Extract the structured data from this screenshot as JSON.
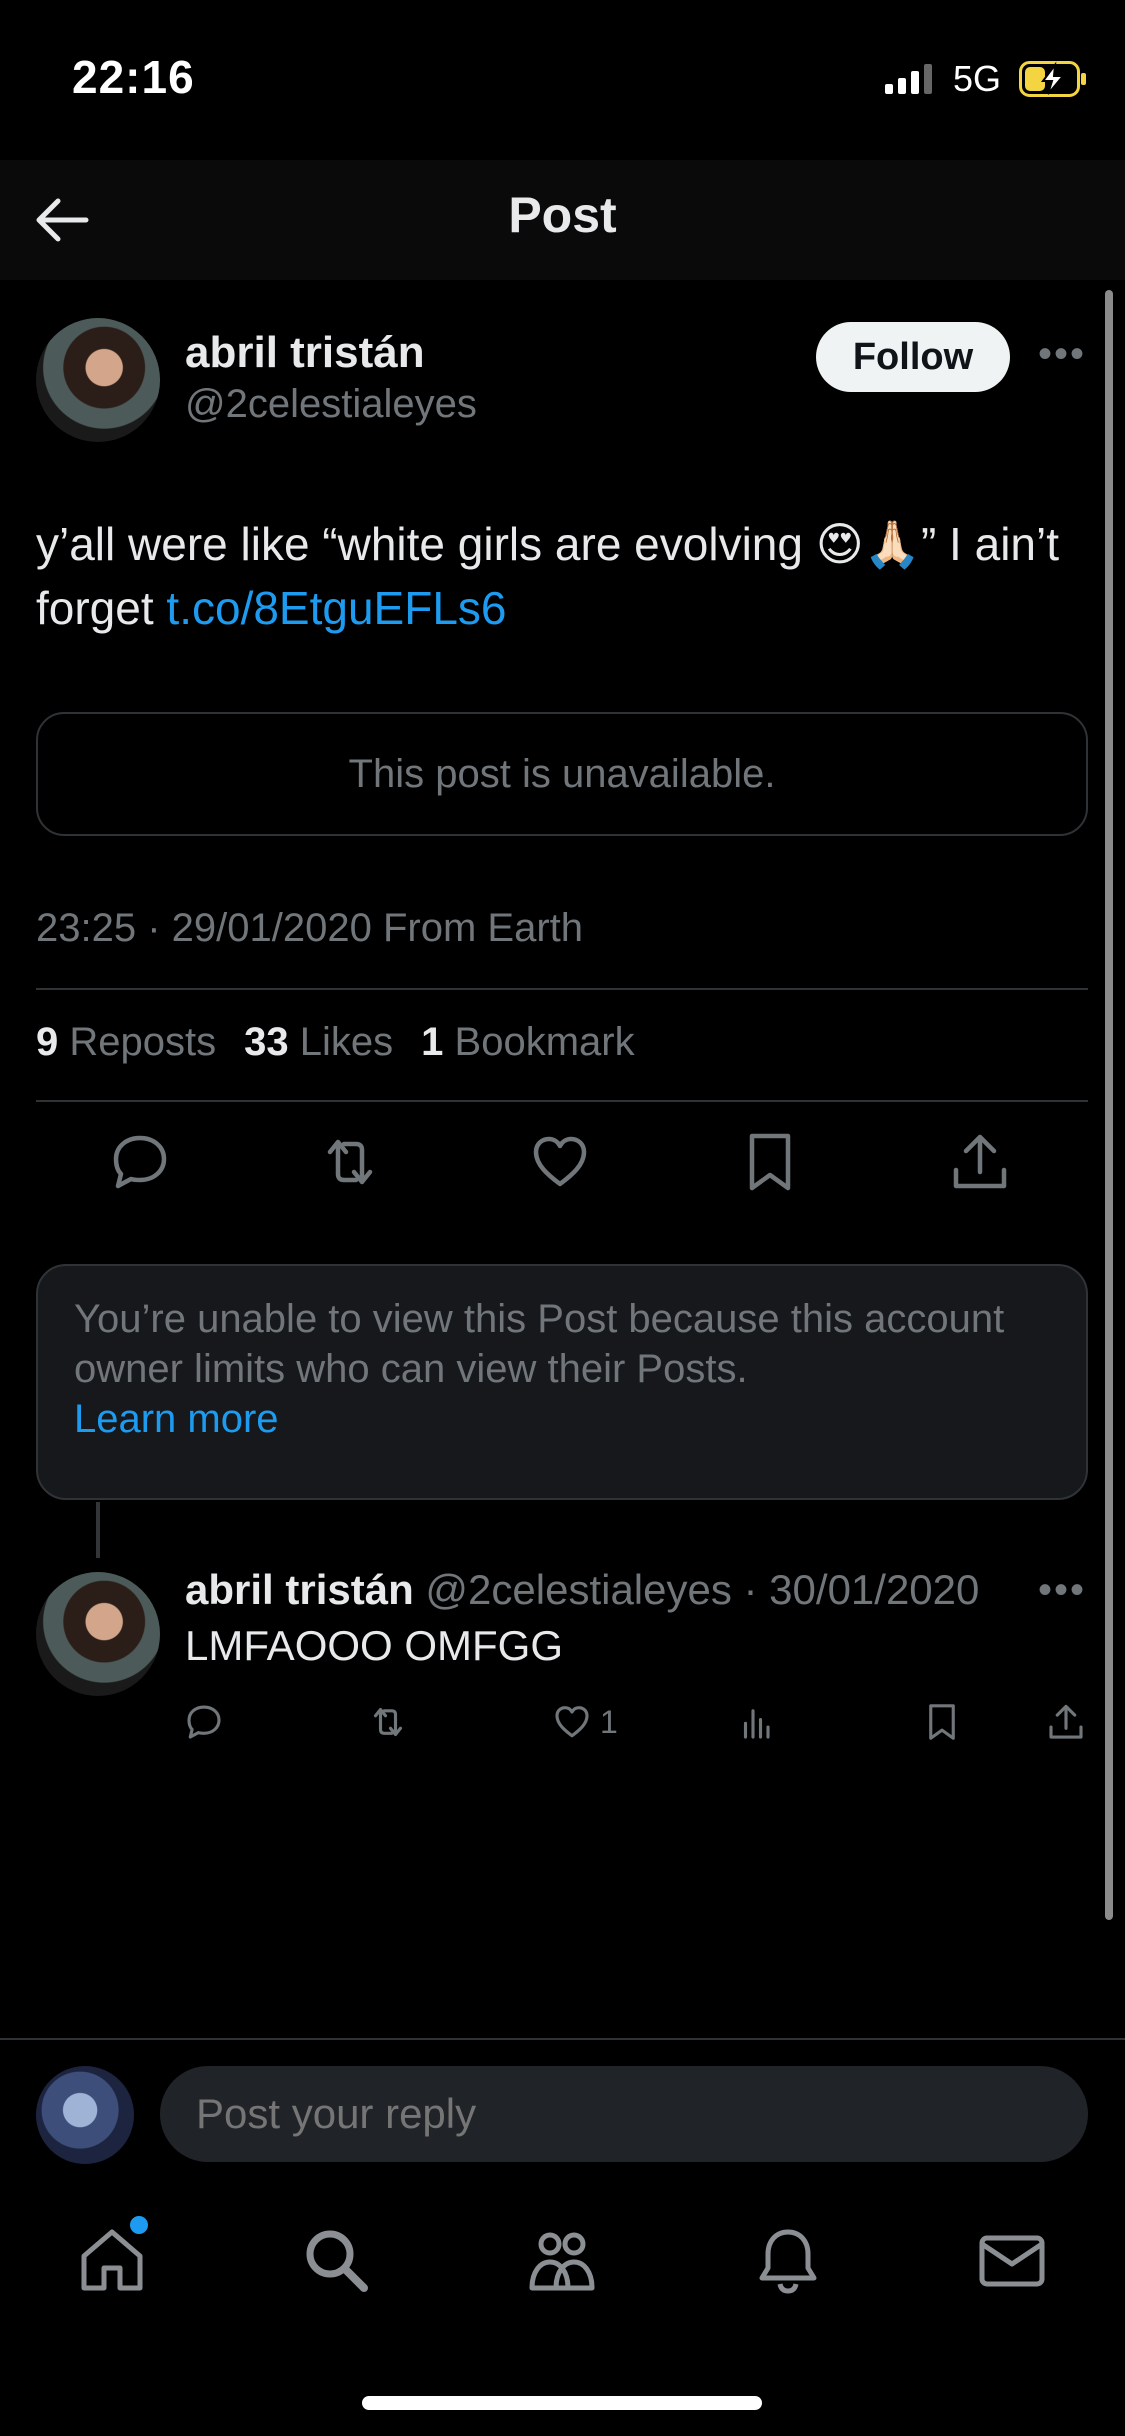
{
  "status_bar": {
    "time": "22:16",
    "network": "5G"
  },
  "header": {
    "title": "Post"
  },
  "post": {
    "author_name": "abril tristán",
    "author_handle": "@2celestialeyes",
    "follow_label": "Follow",
    "text_prefix": "y’all were like “white girls are evolving 😍🙏🏻” I ain’t forget ",
    "link": "t.co/8EtguEFLs6",
    "quoted_unavailable": "This post is unavailable.",
    "timestamp": "23:25 · 29/01/2020 From Earth",
    "stats": {
      "reposts_count": "9",
      "reposts_label": "Reposts",
      "likes_count": "33",
      "likes_label": "Likes",
      "bookmarks_count": "1",
      "bookmarks_label": "Bookmark"
    }
  },
  "limit_notice": {
    "text": "You’re unable to view this Post because this account owner limits who can view their Posts.",
    "link": "Learn more"
  },
  "reply": {
    "author_name": "abril tristán",
    "meta": "@2celestialeyes · 30/01/2020",
    "text": "LMFAOOO OMFGG",
    "like_count": "1"
  },
  "composer": {
    "placeholder": "Post your reply"
  },
  "colors": {
    "accent": "#1d9bf0",
    "background": "#000000",
    "muted": "#71767b"
  },
  "tabs": [
    "home-icon",
    "search-icon",
    "communities-icon",
    "notifications-icon",
    "messages-icon"
  ]
}
